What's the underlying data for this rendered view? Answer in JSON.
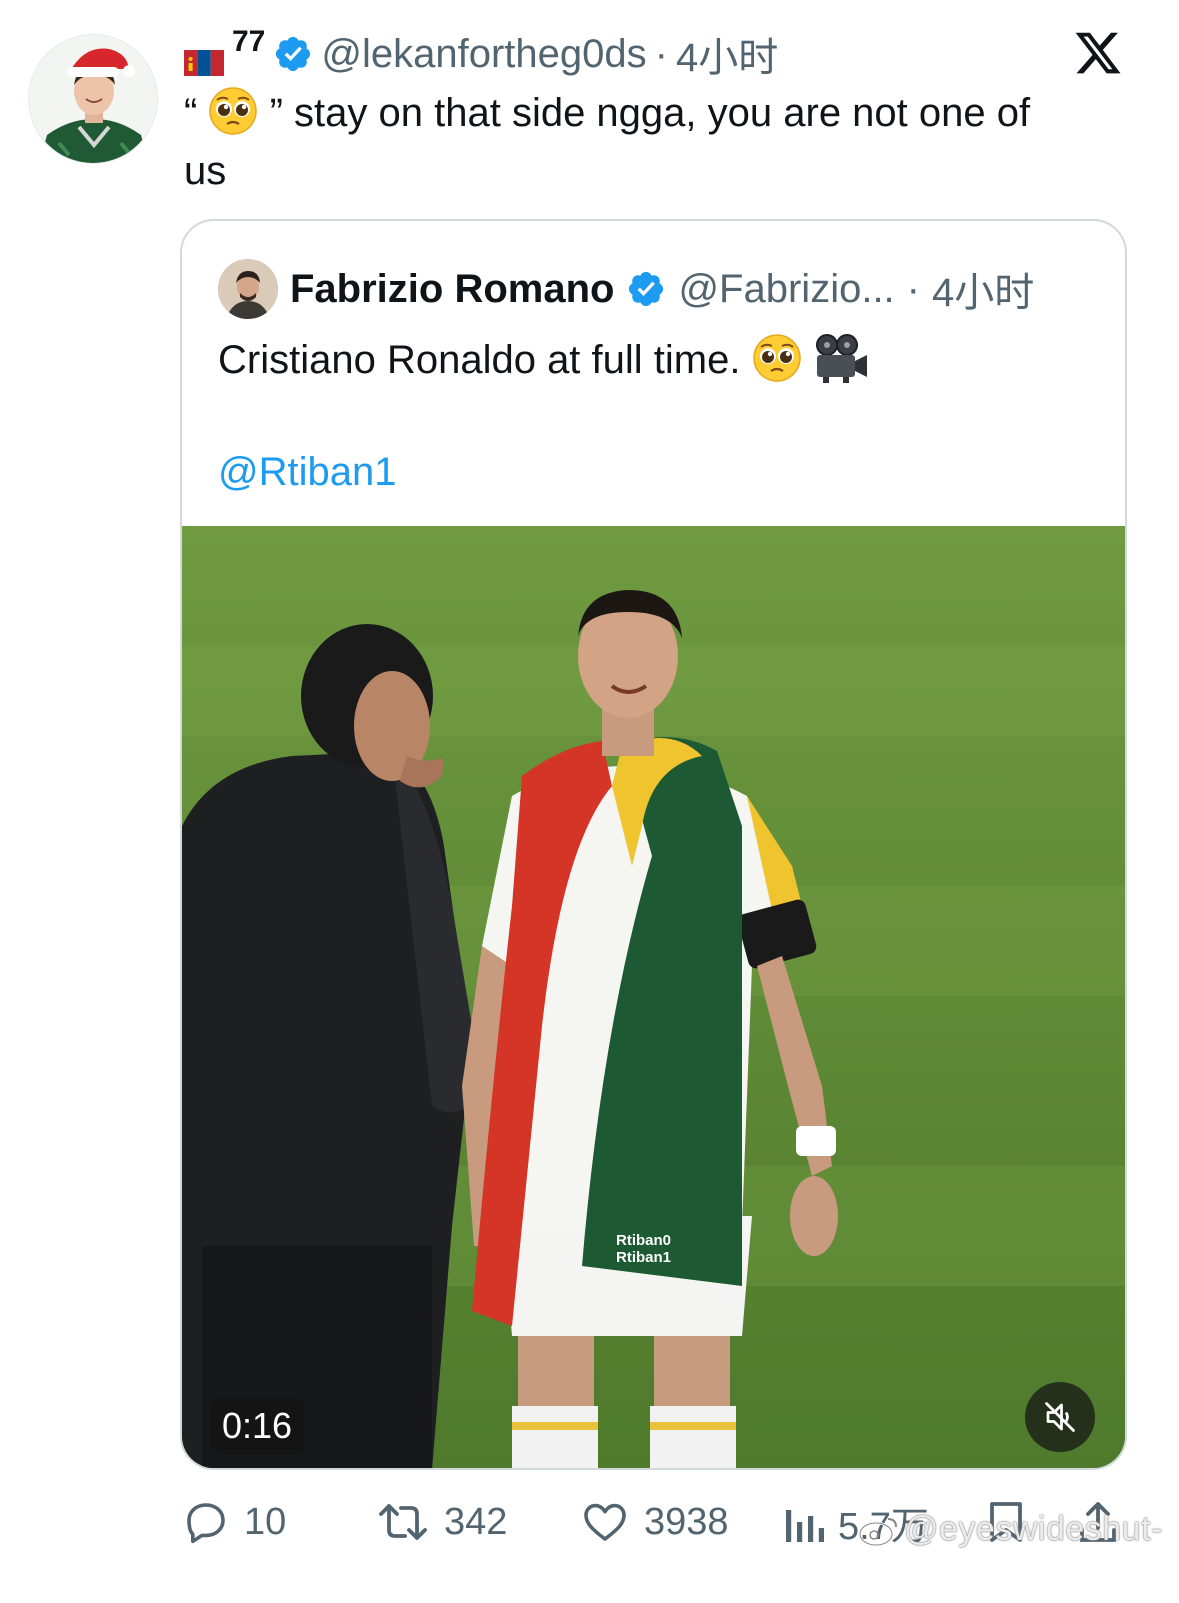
{
  "outer_tweet": {
    "display_name": "77",
    "handle": "@lekanfortheg0ds",
    "separator": "·",
    "time": "4小时",
    "text_open_quote": "“",
    "text_close_quote": "”",
    "text_line1": "stay on that side ngga, you are not one of",
    "text_line2": "us",
    "avatar_icon": "avatar-santa-hat",
    "flag_icon": "mongolia-flag-icon"
  },
  "quoted_tweet": {
    "display_name": "Fabrizio Romano",
    "handle": "@Fabrizio...",
    "separator": "·",
    "time": "4小时",
    "text": "Cristiano Ronaldo at full time.",
    "mention": "@Rtiban1",
    "video": {
      "duration": "0:16",
      "muted": true,
      "overlay_handle_1": "Rtiban0",
      "overlay_handle_2": "Rtiban1"
    }
  },
  "actions": {
    "replies": "10",
    "reposts": "342",
    "likes": "3938",
    "views": "5.7万"
  },
  "watermark": "@eyeswideshut-",
  "colors": {
    "text": "#0f1419",
    "muted": "#536471",
    "link": "#1d9bf0",
    "verified": "#1d9bf0",
    "border": "#cfd9de"
  }
}
